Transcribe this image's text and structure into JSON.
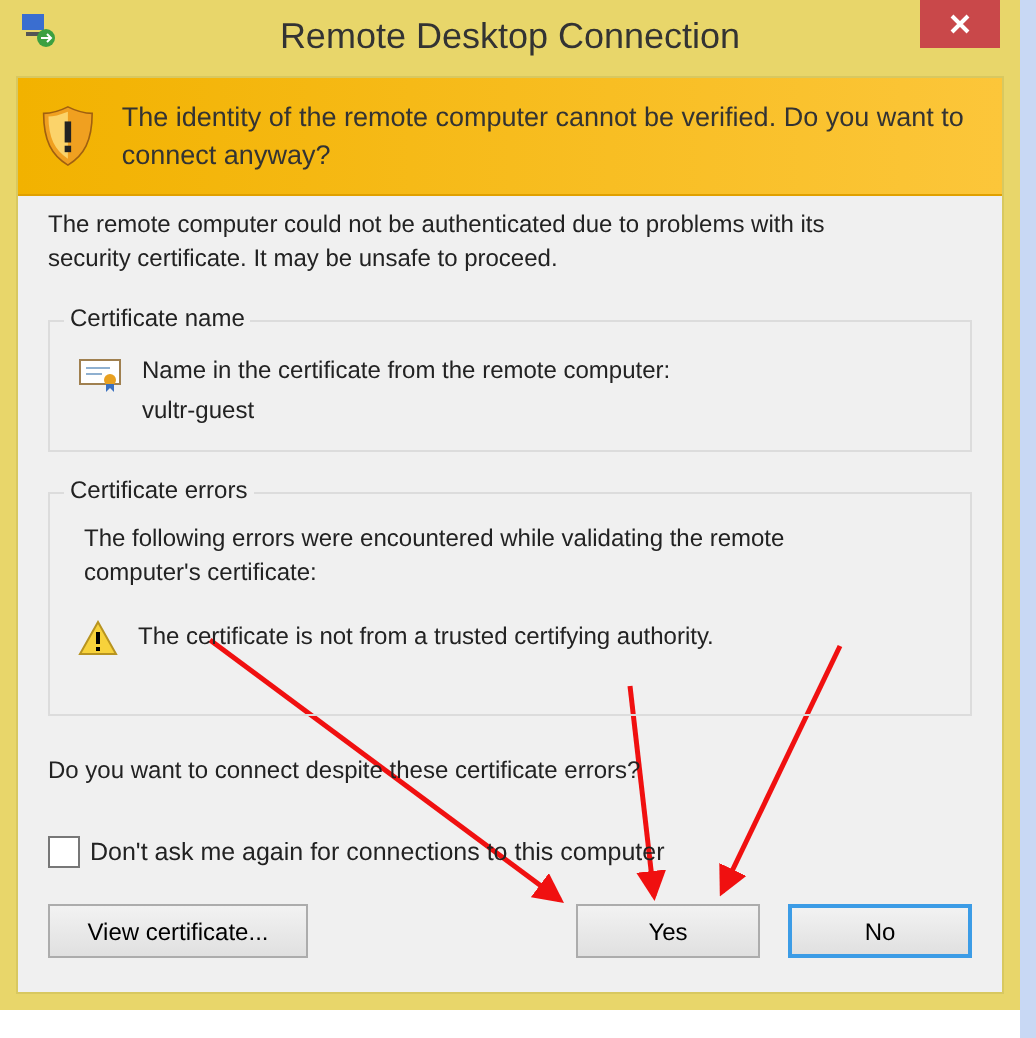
{
  "window": {
    "title": "Remote Desktop Connection"
  },
  "banner": {
    "text": "The identity of the remote computer cannot be verified. Do you want to connect anyway?"
  },
  "description": "The remote computer could not be authenticated due to problems with its security certificate. It may be unsafe to proceed.",
  "groups": [
    {
      "title": "Certificate name",
      "kind": "name",
      "lines": [
        "Name in the certificate from the remote computer:",
        "vultr-guest"
      ]
    },
    {
      "title": "Certificate errors",
      "kind": "errors",
      "intro": "The following errors were encountered while validating the remote computer's certificate:",
      "lines": [
        "The certificate is not from a trusted certifying authority."
      ]
    }
  ],
  "question": "Do you want to connect despite these certificate errors?",
  "checkbox": {
    "label": "Don't ask me again for connections to this computer",
    "checked": false
  },
  "buttons": [
    {
      "label": "View certificate...",
      "default": false
    },
    {
      "label": "Yes",
      "default": false
    },
    {
      "label": "No",
      "default": true
    }
  ]
}
